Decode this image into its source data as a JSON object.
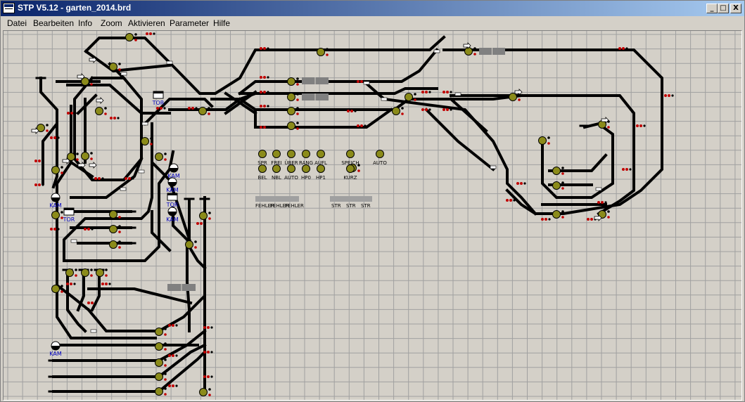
{
  "window": {
    "title": "STP V5.12 - garten_2014.brd",
    "controls": {
      "minimize": "_",
      "maximize": "□",
      "close": "X"
    }
  },
  "menu": [
    "Datei",
    "Bearbeiten",
    "Info",
    "Zoom",
    "Aktivieren",
    "Parameter",
    "Hilfe"
  ],
  "board": {
    "grid_color": "#a0a0a0",
    "track_color": "#000000",
    "signal_color": "#8b8b1a",
    "button_labels_row1": [
      "SPR",
      "FREI",
      "ÜBER",
      "RANG",
      "AUFL"
    ],
    "button_labels_row2": [
      "BEL",
      "NBL",
      "AUTO",
      "HP0",
      "HP1"
    ],
    "button_labels_right": [
      "SPEICH",
      "KURZ",
      "AUTO"
    ],
    "error_labels": [
      "FEHLER",
      "FEHLER",
      "FEHLER"
    ],
    "str_labels": [
      "STR",
      "STR",
      "STR"
    ],
    "device_labels": {
      "tor_1": "TOR",
      "tor_2": "TOR",
      "tor_3": "TOR",
      "kam_1": "KAM",
      "kam_2": "KAM",
      "kam_3": "KAM",
      "kam_4": "KAM",
      "kam_5": "KAM"
    }
  }
}
